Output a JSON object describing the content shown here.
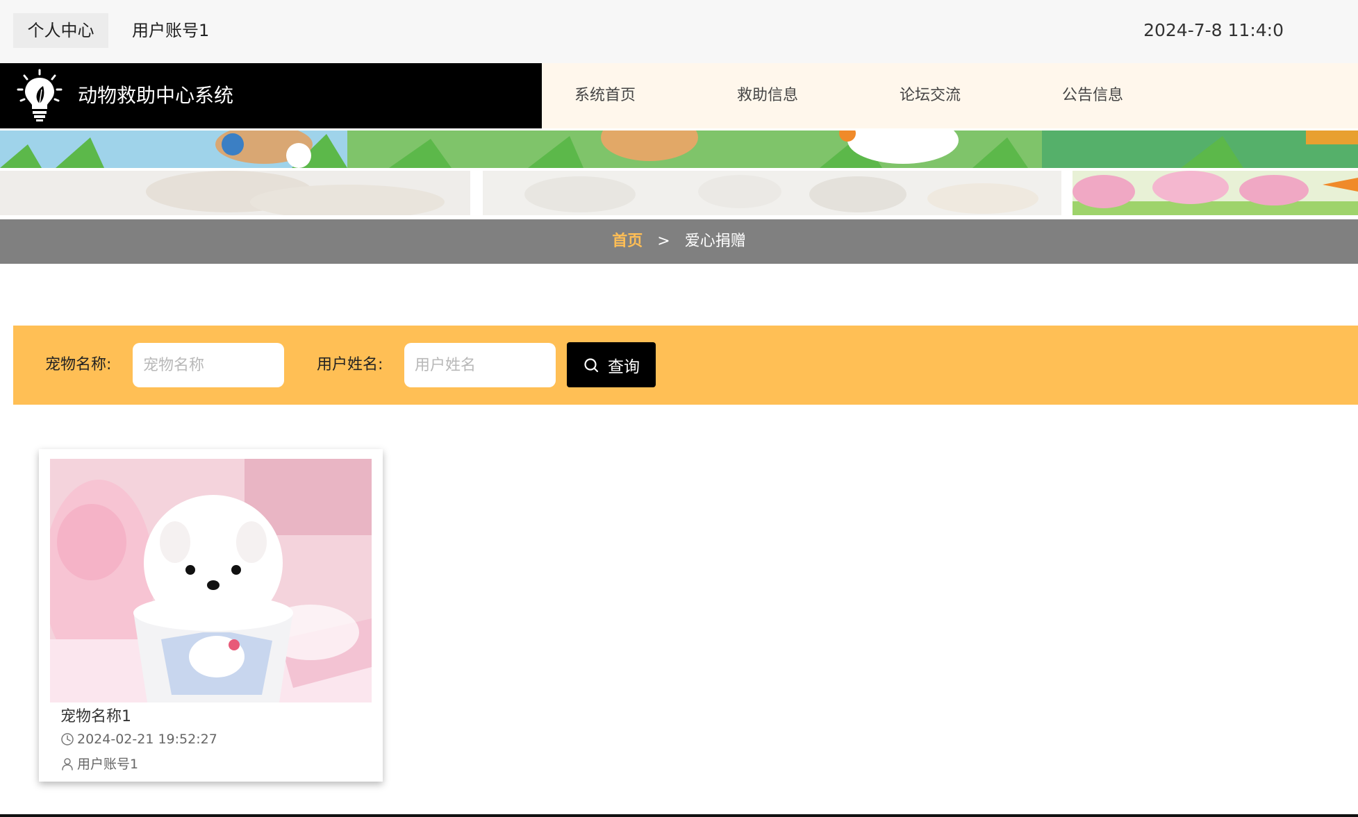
{
  "topbar": {
    "center_label": "个人中心",
    "account_label": "用户账号1",
    "datetime": "2024-7-8 11:4:0"
  },
  "header": {
    "title": "动物救助中心系统",
    "nav": [
      {
        "label": "系统首页"
      },
      {
        "label": "救助信息"
      },
      {
        "label": "论坛交流"
      },
      {
        "label": "公告信息"
      }
    ]
  },
  "breadcrumb": {
    "home": "首页",
    "separator": ">",
    "current": "爱心捐赠"
  },
  "search": {
    "pet_label": "宠物名称:",
    "pet_placeholder": "宠物名称",
    "user_label": "用户姓名:",
    "user_placeholder": "用户姓名",
    "button_label": "查询"
  },
  "cards": [
    {
      "title": "宠物名称1",
      "time": "2024-02-21 19:52:27",
      "user": "用户账号1",
      "icons": {
        "time": "clock-icon",
        "user": "user-icon"
      }
    }
  ],
  "colors": {
    "accent": "#ffbf55",
    "header_bg": "#fff7ec",
    "brand_bg": "#000000",
    "breadcrumb_bg": "#808080"
  }
}
